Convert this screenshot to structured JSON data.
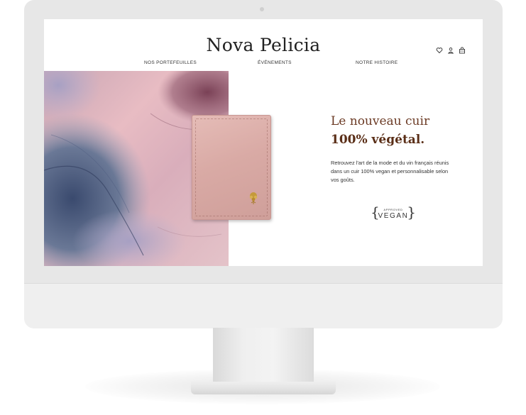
{
  "site": {
    "logo": "Nova Pelicia"
  },
  "nav": {
    "items": [
      {
        "label": "NOS PORTEFEUILLES"
      },
      {
        "label": "ÉVÉNEMENTS"
      },
      {
        "label": "NOTRE HISTOIRE"
      }
    ]
  },
  "header_icons": [
    "heart-icon",
    "user-icon",
    "bag-icon"
  ],
  "hero": {
    "title_line1": "Le nouveau cuir",
    "title_line2": "100% végétal.",
    "description": "Retrouvez l'art de la mode et du vin français réunis dans un cuir 100% vegan et personnalisable selon vos goûts.",
    "badge": {
      "small": "APPROVED",
      "big": "VEGAN"
    }
  },
  "colors": {
    "title": "#6b3a24",
    "wallet": "#dcaea9",
    "monitor": "#e7e7e7"
  }
}
